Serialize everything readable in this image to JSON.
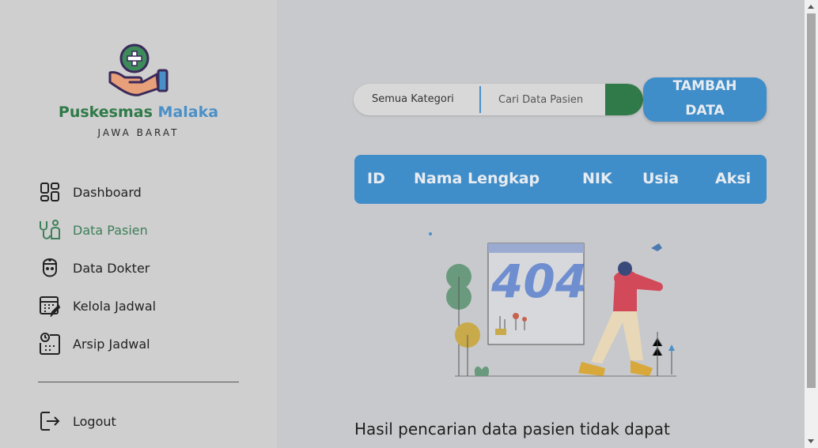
{
  "sidebar": {
    "brand_part1": "Puskesmas",
    "brand_part2": "Malaka",
    "subtitle": "JAWA BARAT",
    "items": [
      {
        "label": "Dashboard",
        "icon": "dashboard-icon"
      },
      {
        "label": "Data Pasien",
        "icon": "stethoscope-icon",
        "active": true
      },
      {
        "label": "Data Dokter",
        "icon": "doctor-icon"
      },
      {
        "label": "Kelola Jadwal",
        "icon": "calendar-edit-icon"
      },
      {
        "label": "Arsip Jadwal",
        "icon": "archive-schedule-icon"
      }
    ],
    "logout_label": "Logout"
  },
  "search": {
    "category": "Semua Kategori",
    "placeholder": "Cari Data Pasien"
  },
  "add_button": "TAMBAH DATA",
  "table": {
    "columns": [
      "ID",
      "Nama Lengkap",
      "NIK",
      "Usia",
      "Aksi"
    ]
  },
  "illustration_text": "404",
  "empty_message": "Hasil pencarian data pasien tidak dapat",
  "colors": {
    "primary_green": "#2f7a48",
    "primary_blue": "#3f8dc9",
    "sidebar_bg": "#cfcfcf",
    "main_bg": "#c8c9cc"
  }
}
